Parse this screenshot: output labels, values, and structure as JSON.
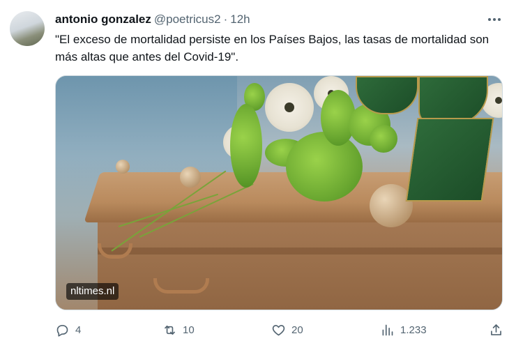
{
  "tweet": {
    "author_name": "antonio gonzalez",
    "handle": "@poetricus2",
    "separator": "·",
    "time": "12h",
    "text": "\"El exceso de mortalidad persiste en los Países Bajos, las tasas de mortalidad son más altas que antes del Covid-19\".",
    "media_source": "nltimes.nl",
    "more_icon": "more-horizontal-icon"
  },
  "actions": {
    "reply": {
      "icon": "reply-icon",
      "count": "4"
    },
    "retweet": {
      "icon": "retweet-icon",
      "count": "10"
    },
    "like": {
      "icon": "heart-icon",
      "count": "20"
    },
    "views": {
      "icon": "views-chart-icon",
      "count": "1.233"
    },
    "share": {
      "icon": "share-icon"
    }
  },
  "colors": {
    "text_primary": "#0f1419",
    "text_secondary": "#536471",
    "border": "#cfd9de"
  }
}
